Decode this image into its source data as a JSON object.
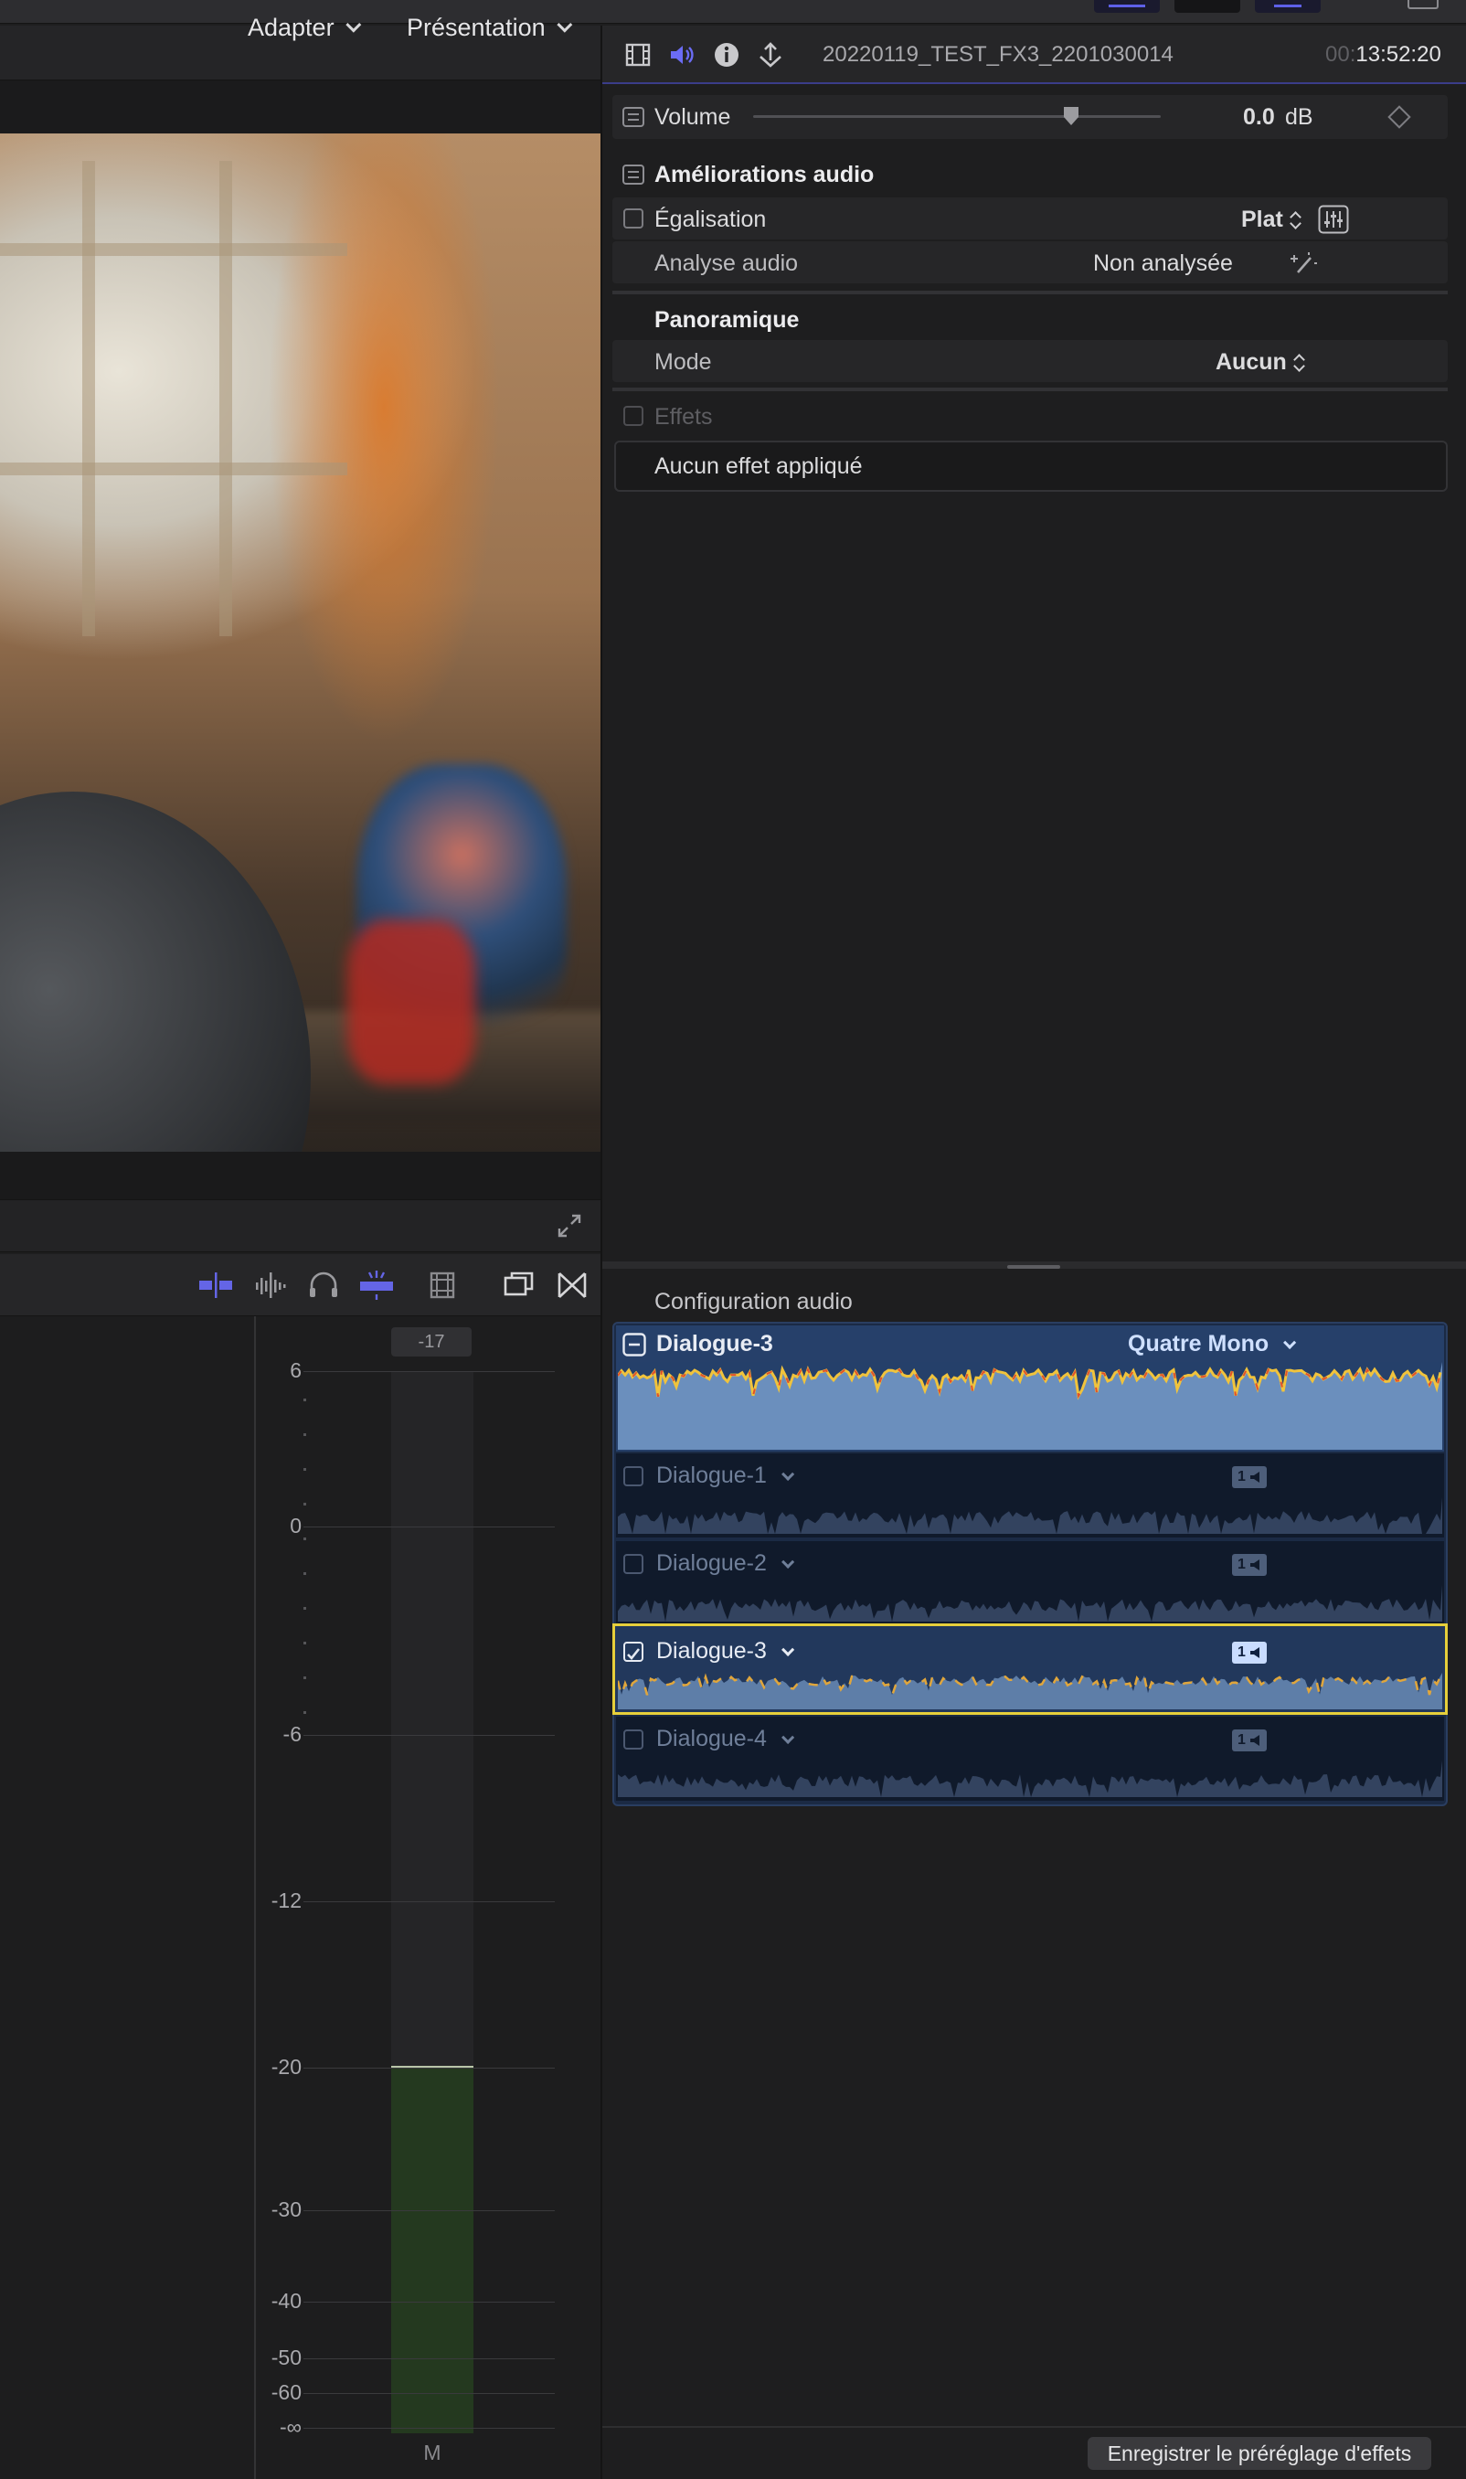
{
  "viewer": {
    "adapter_label": "Adapter",
    "presentation_label": "Présentation"
  },
  "meter": {
    "peak_value": "-17",
    "ticks": [
      "6",
      "0",
      "-6",
      "-12",
      "-20",
      "-30",
      "-40",
      "-50",
      "-60",
      "-∞"
    ],
    "level_db": -20,
    "channel_label": "M"
  },
  "inspector": {
    "clip_name": "20220119_TEST_FX3_2201030014",
    "timecode_dim": "00:",
    "timecode": "13:52:20",
    "volume": {
      "label": "Volume",
      "value": "0.0",
      "unit": "dB",
      "slider_fraction": 0.78
    },
    "enhancements": {
      "title": "Améliorations audio",
      "equalization": {
        "label": "Égalisation",
        "value": "Plat",
        "checked": false
      },
      "analysis": {
        "label": "Analyse audio",
        "value": "Non analysée"
      }
    },
    "pan": {
      "title": "Panoramique",
      "mode_label": "Mode",
      "mode_value": "Aucun"
    },
    "effects": {
      "title": "Effets",
      "empty_label": "Aucun effet appliqué"
    }
  },
  "audio_config": {
    "title": "Configuration audio",
    "main": {
      "name": "Dialogue-3",
      "format": "Quatre Mono"
    },
    "channels": [
      {
        "name": "Dialogue-1",
        "chip": "1",
        "checked": false
      },
      {
        "name": "Dialogue-2",
        "chip": "1",
        "checked": false
      },
      {
        "name": "Dialogue-3",
        "chip": "1",
        "checked": true
      },
      {
        "name": "Dialogue-4",
        "chip": "1",
        "checked": false
      }
    ]
  },
  "footer": {
    "save_preset_label": "Enregistrer le préréglage d'effets"
  },
  "colors": {
    "accent": "#6b6cf5",
    "selection_outline": "#e6cf3b",
    "meter_fill": "#24391f",
    "waveform_active": "#6b8fbd"
  }
}
